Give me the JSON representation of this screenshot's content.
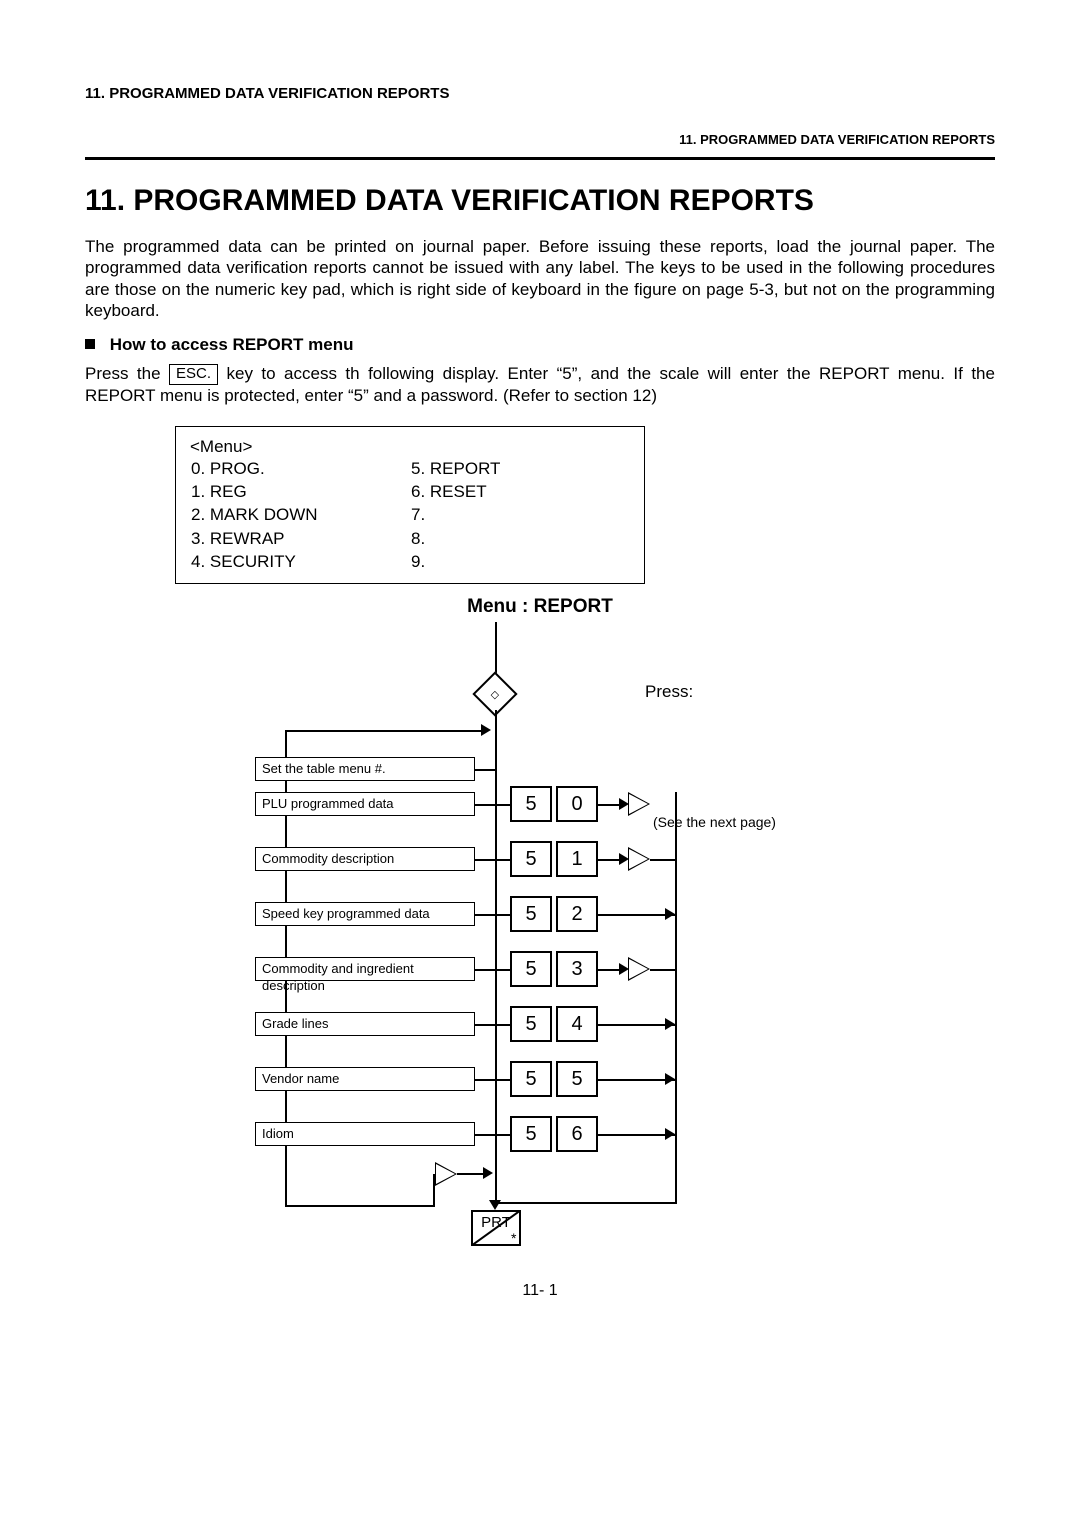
{
  "header": {
    "left": "11.  PROGRAMMED DATA VERIFICATION REPORTS",
    "right": "11. PROGRAMMED DATA VERIFICATION REPORTS"
  },
  "title": "11.  PROGRAMMED DATA VERIFICATION REPORTS",
  "intro": "The programmed data can be printed on journal paper.   Before issuing these reports, load the journal paper.   The programmed data verification reports cannot be issued with any label.   The keys to be used in the following procedures are those on the numeric key pad, which is right side of keyboard in the figure on page 5-3, but not on the programming keyboard.",
  "subhead": "How to access REPORT menu",
  "press_line1": "Press the ",
  "esc_key": "ESC.",
  "press_line2": " key to access th following display.   Enter “5”, and the scale will enter the REPORT menu.   If the REPORT menu is protected, enter “5” and a password.   (Refer to section 12)",
  "menu": {
    "header": "<Menu>",
    "left": [
      "0.  PROG.",
      "1.  REG",
      "2.  MARK DOWN",
      "3.  REWRAP",
      "4.  SECURITY"
    ],
    "right": [
      "5.  REPORT",
      "6.  RESET",
      "7.",
      "8.",
      "9."
    ]
  },
  "flow_title": "Menu :   REPORT",
  "press_label": "Press:",
  "see_next": "(See the next page)",
  "rows": [
    {
      "desc": "Set the table menu #."
    },
    {
      "desc": "PLU programmed data",
      "a": "5",
      "b": "0",
      "u": true
    },
    {
      "desc": "Commodity description",
      "a": "5",
      "b": "1",
      "u": true
    },
    {
      "desc": "Speed key programmed data",
      "a": "5",
      "b": "2"
    },
    {
      "desc": "Commodity and ingredient description",
      "a": "5",
      "b": "3",
      "u": true
    },
    {
      "desc": "Grade lines",
      "a": "5",
      "b": "4"
    },
    {
      "desc": "Vendor name",
      "a": "5",
      "b": "5"
    },
    {
      "desc": "Idiom",
      "a": "5",
      "b": "6"
    }
  ],
  "v_key": "v",
  "u_key": "u",
  "prt_key": "PRT",
  "prt_star": "*",
  "page_number": "11- 1"
}
